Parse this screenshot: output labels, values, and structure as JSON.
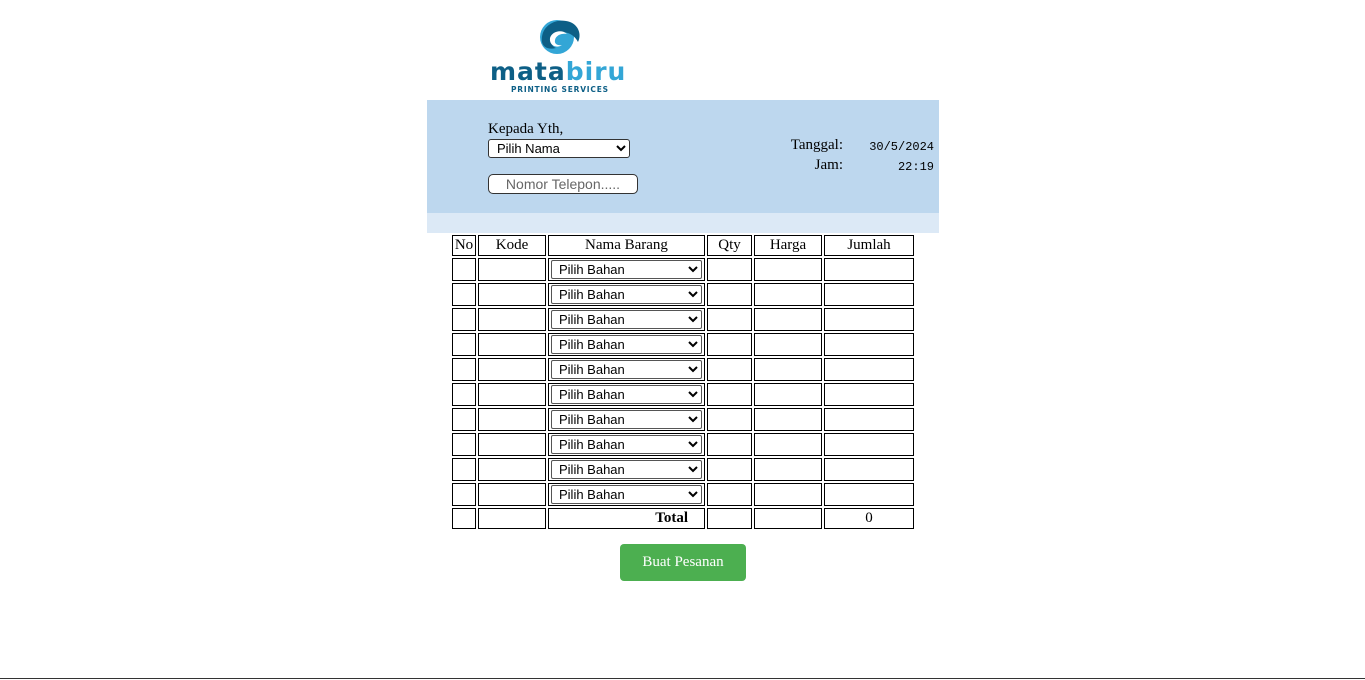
{
  "brand": {
    "name_part1": "mata",
    "name_part2": "biru",
    "tagline": "PRINTING SERVICES"
  },
  "header": {
    "kepada_label": "Kepada Yth,",
    "nama_select": {
      "selected": "Pilih Nama",
      "options": [
        "Pilih Nama"
      ]
    },
    "phone_placeholder": "Nomor Telepon.....",
    "tanggal_label": "Tanggal:",
    "tanggal_value": "30/5/2024",
    "jam_label": "Jam:",
    "jam_value": "22:19"
  },
  "table": {
    "columns": [
      "No",
      "Kode",
      "Nama Barang",
      "Qty",
      "Harga",
      "Jumlah"
    ],
    "rows": [
      {
        "no": "",
        "kode": "",
        "bahan": "Pilih Bahan",
        "qty": "",
        "harga": "",
        "jumlah": ""
      },
      {
        "no": "",
        "kode": "",
        "bahan": "Pilih Bahan",
        "qty": "",
        "harga": "",
        "jumlah": ""
      },
      {
        "no": "",
        "kode": "",
        "bahan": "Pilih Bahan",
        "qty": "",
        "harga": "",
        "jumlah": ""
      },
      {
        "no": "",
        "kode": "",
        "bahan": "Pilih Bahan",
        "qty": "",
        "harga": "",
        "jumlah": ""
      },
      {
        "no": "",
        "kode": "",
        "bahan": "Pilih Bahan",
        "qty": "",
        "harga": "",
        "jumlah": ""
      },
      {
        "no": "",
        "kode": "",
        "bahan": "Pilih Bahan",
        "qty": "",
        "harga": "",
        "jumlah": ""
      },
      {
        "no": "",
        "kode": "",
        "bahan": "Pilih Bahan",
        "qty": "",
        "harga": "",
        "jumlah": ""
      },
      {
        "no": "",
        "kode": "",
        "bahan": "Pilih Bahan",
        "qty": "",
        "harga": "",
        "jumlah": ""
      },
      {
        "no": "",
        "kode": "",
        "bahan": "Pilih Bahan",
        "qty": "",
        "harga": "",
        "jumlah": ""
      },
      {
        "no": "",
        "kode": "",
        "bahan": "Pilih Bahan",
        "qty": "",
        "harga": "",
        "jumlah": ""
      }
    ],
    "total_label": "Total",
    "total_value": "0"
  },
  "submit_label": "Buat Pesanan",
  "colors": {
    "header_bg": "#bdd7ee",
    "header_strip": "#dce9f6",
    "button": "#4caf50",
    "brand_dark": "#0d5f86",
    "brand_light": "#33a6d6"
  }
}
